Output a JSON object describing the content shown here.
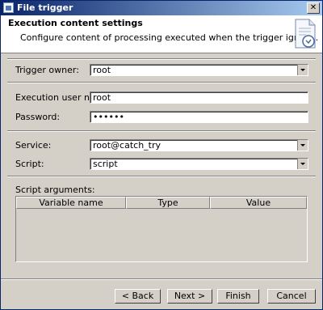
{
  "window": {
    "title": "File trigger",
    "close_glyph": "✕"
  },
  "header": {
    "title": "Execution content settings",
    "description": "Configure content of processing executed when the trigger ignites.",
    "icon": "document-clock-icon"
  },
  "form": {
    "trigger_owner": {
      "label": "Trigger owner:",
      "value": "root"
    },
    "exec_user": {
      "label": "Execution user name:",
      "value": "root"
    },
    "password": {
      "label": "Password:",
      "value": "••••••"
    },
    "service": {
      "label": "Service:",
      "value": "root@catch_try"
    },
    "script": {
      "label": "Script:",
      "value": "script"
    },
    "script_args": {
      "label": "Script arguments:",
      "columns": [
        "Variable name",
        "Type",
        "Value"
      ]
    }
  },
  "buttons": {
    "back": "< Back",
    "next": "Next >",
    "finish": "Finish",
    "cancel": "Cancel"
  }
}
